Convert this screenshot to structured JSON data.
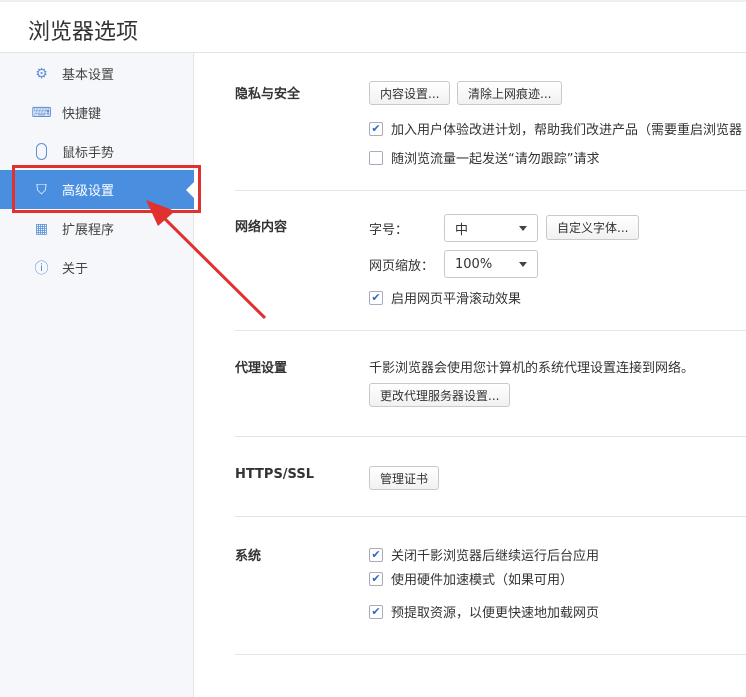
{
  "header": {
    "title": "浏览器选项"
  },
  "sidebar": {
    "items": [
      {
        "label": "基本设置",
        "icon": "gear-icon"
      },
      {
        "label": "快捷键",
        "icon": "keyboard-icon"
      },
      {
        "label": "鼠标手势",
        "icon": "mouse-icon"
      },
      {
        "label": "高级设置",
        "icon": "shield-icon",
        "active": true
      },
      {
        "label": "扩展程序",
        "icon": "extensions-icon"
      },
      {
        "label": "关于",
        "icon": "info-icon"
      }
    ]
  },
  "privacy": {
    "label": "隐私与安全",
    "content_btn": "内容设置...",
    "clear_btn": "清除上网痕迹...",
    "opt1": {
      "label": "加入用户体验改进计划，帮助我们改进产品（需要重启浏览器",
      "checked": true
    },
    "opt2": {
      "label": "随浏览流量一起发送“请勿跟踪”请求",
      "checked": false
    }
  },
  "web": {
    "label": "网络内容",
    "font_label": "字号：",
    "font_value": "中",
    "custom_font_btn": "自定义字体...",
    "zoom_label": "网页缩放：",
    "zoom_value": "100%",
    "smooth": {
      "label": "启用网页平滑滚动效果",
      "checked": true
    }
  },
  "proxy": {
    "label": "代理设置",
    "desc": "千影浏览器会使用您计算机的系统代理设置连接到网络。",
    "btn": "更改代理服务器设置..."
  },
  "https": {
    "label": "HTTPS/SSL",
    "btn": "管理证书"
  },
  "system": {
    "label": "系统",
    "opt1": {
      "label": "关闭千影浏览器后继续运行后台应用",
      "checked": true
    },
    "opt2": {
      "label": "使用硬件加速模式（如果可用）",
      "checked": true
    },
    "opt3": {
      "label": "预提取资源，以便更快速地加载网页",
      "checked": true
    }
  }
}
